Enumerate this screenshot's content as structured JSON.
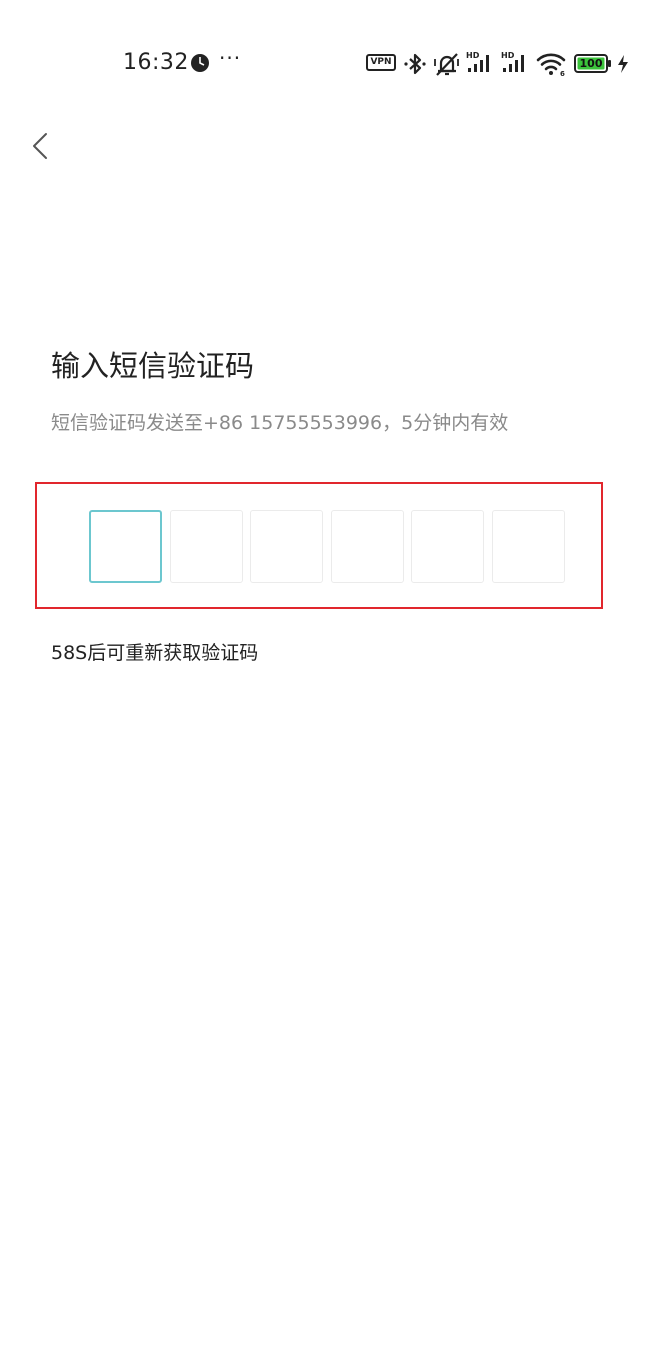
{
  "status_bar": {
    "time": "16:32",
    "more": "···",
    "vpn_label": "VPN",
    "battery_level": "100",
    "icons": [
      "clock-icon",
      "vpn-icon",
      "bluetooth-icon",
      "vibrate-off-icon",
      "signal-hd-icon",
      "signal-hd-icon",
      "wifi-icon",
      "battery-icon",
      "charging-icon"
    ],
    "battery_color": "#3bc43b"
  },
  "nav": {
    "back_icon": "chevron-left-icon"
  },
  "page": {
    "title": "输入短信验证码",
    "subtitle": "短信验证码发送至+86 15755553996，5分钟内有效",
    "resend_text": "58S后可重新获取验证码"
  },
  "code_input": {
    "length": 6,
    "digits": [
      "",
      "",
      "",
      "",
      "",
      ""
    ],
    "active_index": 0,
    "active_border_color": "#6cc7cf",
    "highlight_color": "#e1262d"
  }
}
